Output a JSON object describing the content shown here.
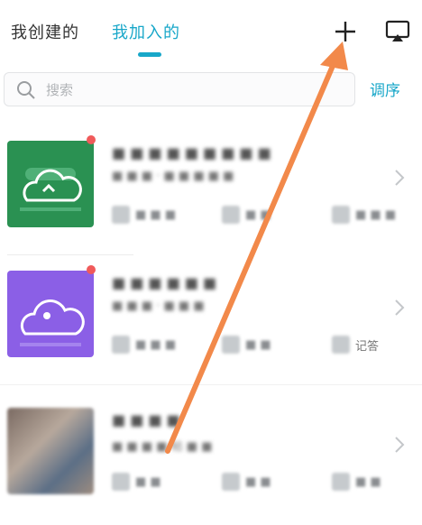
{
  "tabs": {
    "created_label": "我创建的",
    "joined_label": "我加入的"
  },
  "search": {
    "placeholder": "搜索",
    "sort_label": "调序"
  },
  "icons": {
    "add": "plus-icon",
    "cast": "screen-cast-icon",
    "search": "magnifier-icon",
    "chevron": "chevron-right-icon"
  },
  "groups": [
    {
      "name": "■ ■ ■ ■ ■ ■ ■ ■ ■",
      "subtitle": "■ ■ ■ · ■ ■ ■ ■ ■",
      "stats": [
        "■ ■ ■",
        "■ ■",
        "■ ■ ■"
      ]
    },
    {
      "name": "■ ■ ■ ■ ■ ■",
      "subtitle": "■ ■ ■ · ■ ■ ■",
      "stats": [
        "■ ■ ■",
        "■ ■",
        "记答"
      ]
    },
    {
      "name": "■ ■ ■ ■",
      "subtitle": "■ ■ ■ ■ 帖 ■ ■",
      "stats": [
        "■ ■",
        "■ ■",
        "■ ■"
      ]
    }
  ],
  "colors": {
    "accent": "#18a7c9",
    "thumb_green": "#2a9152",
    "thumb_purple": "#8b5fe6",
    "annotation_arrow": "#f2894a",
    "unread_dot": "#f05a5a"
  }
}
